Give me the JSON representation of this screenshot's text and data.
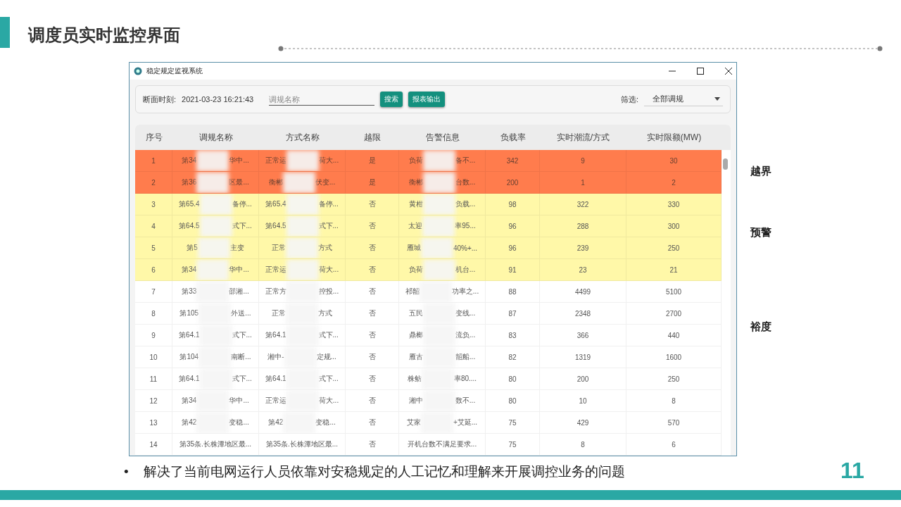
{
  "slide": {
    "title": "调度员实时监控界面",
    "page_number": "11",
    "bullet_mark": "•",
    "bullet": "解决了当前电网运行人员依靠对安稳规定的人工记忆和理解来开展调控业务的问题"
  },
  "window": {
    "title": "稳定规定监视系统"
  },
  "toolbar": {
    "time_label": "断面时刻:",
    "time_value": "2021-03-23 16:21:43",
    "search": {
      "placeholder": "调规名称"
    },
    "buttons": [
      "搜索",
      "报表输出"
    ],
    "filter_label": "筛选:",
    "filter_value": "全部调规"
  },
  "table": {
    "columns": [
      "序号",
      "调规名称",
      "方式名称",
      "越限",
      "告警信息",
      "负载率",
      "实时潮流/方式",
      "实时限额(MW)"
    ],
    "rows": [
      {
        "kind": "over",
        "index": "1",
        "name": [
          "第34",
          "华中..."
        ],
        "mode": [
          "正常运",
          "荷大..."
        ],
        "exceed": "是",
        "alarm": [
          "负荷",
          "备不..."
        ],
        "load": "342",
        "flow": "9",
        "limit": "30"
      },
      {
        "kind": "over",
        "index": "2",
        "name": [
          "第36",
          "区最..."
        ],
        "mode": [
          "衡郴",
          "伏变..."
        ],
        "exceed": "是",
        "alarm": [
          "衡郴",
          "台数..."
        ],
        "load": "200",
        "flow": "1",
        "limit": "2"
      },
      {
        "kind": "warning",
        "index": "3",
        "name": [
          "第65.4",
          "备停..."
        ],
        "mode": [
          "第65.4",
          "备停..."
        ],
        "exceed": "否",
        "alarm": [
          "黄柑",
          "负载..."
        ],
        "load": "98",
        "flow": "322",
        "limit": "330"
      },
      {
        "kind": "warning",
        "index": "4",
        "name": [
          "第64.5",
          "式下..."
        ],
        "mode": [
          "第64.5",
          "式下..."
        ],
        "exceed": "否",
        "alarm": [
          "太迎",
          "率95..."
        ],
        "load": "96",
        "flow": "288",
        "limit": "300"
      },
      {
        "kind": "warning",
        "index": "5",
        "name": [
          "第5",
          "主变"
        ],
        "mode": [
          "正常",
          "方式"
        ],
        "exceed": "否",
        "alarm": [
          "雁城",
          "40%+..."
        ],
        "load": "96",
        "flow": "239",
        "limit": "250"
      },
      {
        "kind": "warning",
        "index": "6",
        "name": [
          "第34",
          "华中..."
        ],
        "mode": [
          "正常运",
          "荷大..."
        ],
        "exceed": "否",
        "alarm": [
          "负荷",
          "机台..."
        ],
        "load": "91",
        "flow": "23",
        "limit": "21"
      },
      {
        "kind": "normal",
        "index": "7",
        "name": [
          "第33",
          "邵湘..."
        ],
        "mode": [
          "正常方",
          "控投..."
        ],
        "exceed": "否",
        "alarm": [
          "祁韶",
          "功率之..."
        ],
        "load": "88",
        "flow": "4499",
        "limit": "5100"
      },
      {
        "kind": "normal",
        "index": "8",
        "name": [
          "第105",
          "外送..."
        ],
        "mode": [
          "正常",
          "方式"
        ],
        "exceed": "否",
        "alarm": [
          "五民",
          "变线..."
        ],
        "load": "87",
        "flow": "2348",
        "limit": "2700"
      },
      {
        "kind": "normal",
        "index": "9",
        "name": [
          "第64.1",
          "式下..."
        ],
        "mode": [
          "第64.1",
          "式下..."
        ],
        "exceed": "否",
        "alarm": [
          "鼎榔",
          "流负..."
        ],
        "load": "83",
        "flow": "366",
        "limit": "440"
      },
      {
        "kind": "normal",
        "index": "10",
        "name": [
          "第104",
          "南断..."
        ],
        "mode": [
          "湘中-",
          "定规..."
        ],
        "exceed": "否",
        "alarm": [
          "雁古",
          "韶船..."
        ],
        "load": "82",
        "flow": "1319",
        "limit": "1600"
      },
      {
        "kind": "normal",
        "index": "11",
        "name": [
          "第64.1",
          "式下..."
        ],
        "mode": [
          "第64.1",
          "式下..."
        ],
        "exceed": "否",
        "alarm": [
          "株鲂",
          "率80...."
        ],
        "load": "80",
        "flow": "200",
        "limit": "250"
      },
      {
        "kind": "normal",
        "index": "12",
        "name": [
          "第34",
          "华中..."
        ],
        "mode": [
          "正常运",
          "荷大..."
        ],
        "exceed": "否",
        "alarm": [
          "湘中",
          "数不..."
        ],
        "load": "80",
        "flow": "10",
        "limit": "8"
      },
      {
        "kind": "normal",
        "index": "13",
        "name": [
          "第42",
          "变稳..."
        ],
        "mode": [
          "第42",
          "变稳..."
        ],
        "exceed": "否",
        "alarm": [
          "艾家",
          "+艾延..."
        ],
        "load": "75",
        "flow": "429",
        "limit": "570"
      },
      {
        "kind": "normal",
        "index": "14",
        "name": [
          "第35条.长株潭地区最..."
        ],
        "mode": [
          "第35条.长株潭地区最..."
        ],
        "exceed": "否",
        "alarm": [
          "开机台数不满足要求..."
        ],
        "load": "75",
        "flow": "8",
        "limit": "6"
      }
    ]
  },
  "legend": [
    "越界",
    "预警",
    "裕度"
  ]
}
